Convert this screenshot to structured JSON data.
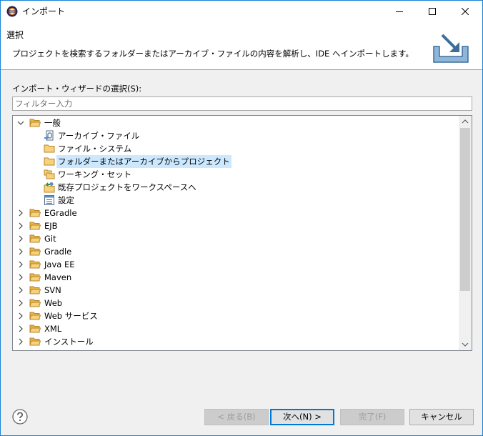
{
  "window": {
    "title": "インポート"
  },
  "header": {
    "title": "選択",
    "description": "プロジェクトを検索するフォルダーまたはアーカイブ・ファイルの内容を解析し、IDE へインポートします。"
  },
  "wizard": {
    "selection_label": "インポート・ウィザードの選択(S):",
    "filter_placeholder": "フィルター入力"
  },
  "tree": {
    "general": {
      "label": "一般",
      "children": [
        {
          "label": "アーカイブ・ファイル",
          "icon": "archive-file-icon"
        },
        {
          "label": "ファイル・システム",
          "icon": "folder-icon"
        },
        {
          "label": "フォルダーまたはアーカイブからプロジェクト",
          "icon": "folder-icon",
          "selected": true
        },
        {
          "label": "ワーキング・セット",
          "icon": "working-set-icon"
        },
        {
          "label": "既存プロジェクトをワークスペースへ",
          "icon": "existing-project-icon"
        },
        {
          "label": "設定",
          "icon": "preferences-icon"
        }
      ]
    },
    "categories": [
      "EGradle",
      "EJB",
      "Git",
      "Gradle",
      "Java EE",
      "Maven",
      "SVN",
      "Web",
      "Web サービス",
      "XML",
      "インストール"
    ]
  },
  "buttons": {
    "back": "< 戻る(B)",
    "next": "次へ(N) >",
    "finish": "完了(F)",
    "cancel": "キャンセル"
  },
  "colors": {
    "accent": "#0078d7",
    "selection": "#cce8ff",
    "folder": "#e8b54a"
  }
}
